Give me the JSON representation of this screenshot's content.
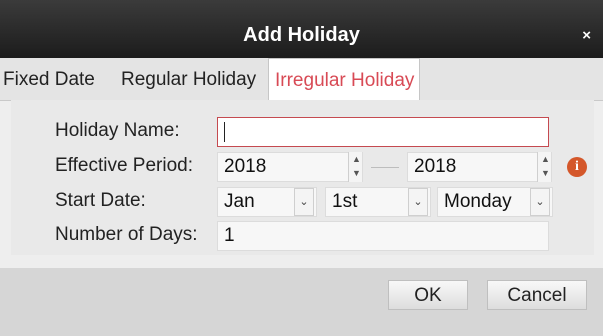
{
  "dialog": {
    "title": "Add Holiday",
    "close_glyph": "×"
  },
  "tabs": [
    {
      "label": "Fixed Date",
      "active": false
    },
    {
      "label": "Regular Holiday",
      "active": false
    },
    {
      "label": "Irregular Holiday",
      "active": true
    }
  ],
  "form": {
    "holiday_name": {
      "label": "Holiday Name:",
      "value": ""
    },
    "effective_period": {
      "label": "Effective Period:",
      "from": "2018",
      "to": "2018",
      "info_glyph": "i"
    },
    "start_date": {
      "label": "Start Date:",
      "month": "Jan",
      "week": "1st",
      "day": "Monday"
    },
    "number_of_days": {
      "label": "Number of Days:",
      "value": "1"
    }
  },
  "buttons": {
    "ok": "OK",
    "cancel": "Cancel"
  },
  "colors": {
    "accent": "#d84a55",
    "info": "#d4572a",
    "titlebar": "#2a2a2a"
  }
}
